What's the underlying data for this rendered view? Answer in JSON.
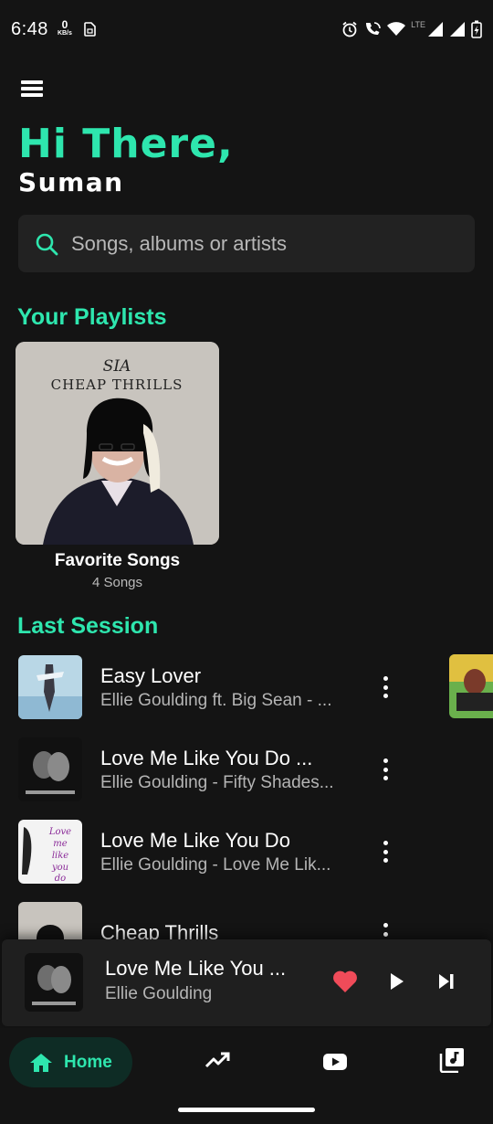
{
  "status_bar": {
    "time": "6:48",
    "net_speed_value": "0",
    "net_speed_unit": "KB/s",
    "network_type": "LTE"
  },
  "header": {
    "greeting": "Hi There,",
    "username": "Suman"
  },
  "search": {
    "placeholder": "Songs, albums or artists"
  },
  "playlists_section": {
    "title": "Your Playlists",
    "items": [
      {
        "name": "Favorite Songs",
        "count": "4 Songs",
        "art_text": [
          "SIA",
          "CHEAP THRILLS"
        ]
      }
    ]
  },
  "last_session": {
    "title": "Last Session",
    "songs": [
      {
        "title": "Easy Lover",
        "subtitle": "Ellie Goulding ft. Big Sean - ..."
      },
      {
        "title": "Love Me Like You Do ...",
        "subtitle": "Ellie Goulding - Fifty Shades..."
      },
      {
        "title": "Love Me Like You Do",
        "subtitle": "Ellie Goulding - Love Me Lik..."
      },
      {
        "title": "Cheap Thrills",
        "subtitle": ""
      }
    ]
  },
  "mini_player": {
    "title": "Love Me Like You ...",
    "artist": "Ellie Goulding",
    "liked": true
  },
  "bottom_nav": {
    "home_label": "Home",
    "items": [
      "home-icon",
      "trending-icon",
      "youtube-icon",
      "library-music-icon"
    ]
  },
  "colors": {
    "accent": "#2ee6ae",
    "background": "#141414",
    "heart": "#f04b59"
  }
}
